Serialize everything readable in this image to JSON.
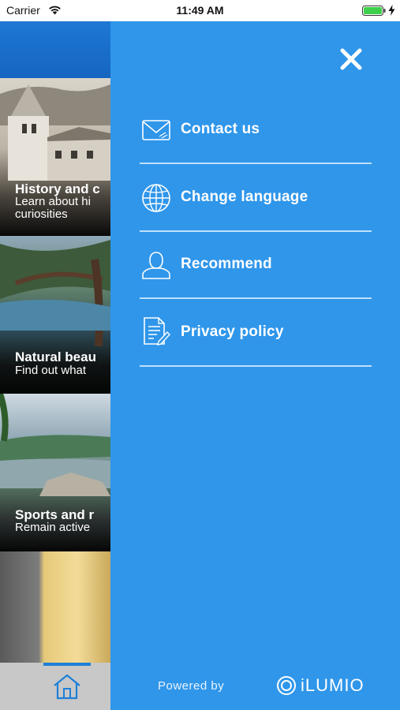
{
  "status_bar": {
    "carrier": "Carrier",
    "time": "11:49 AM"
  },
  "main": {
    "cards": [
      {
        "title": "History and c",
        "subtitle_line1": "Learn about hi",
        "subtitle_line2": "curiosities"
      },
      {
        "title": "Natural beau",
        "subtitle_line1": "Find out what"
      },
      {
        "title": "Sports and r",
        "subtitle_line1": "Remain active"
      },
      {
        "title": ""
      }
    ],
    "tab_bar": {
      "active_tab": "home-icon"
    }
  },
  "drawer": {
    "close_icon": "close-icon",
    "menu": [
      {
        "label": "Contact us",
        "icon": "envelope-icon"
      },
      {
        "label": "Change language",
        "icon": "globe-icon"
      },
      {
        "label": "Recommend",
        "icon": "user-icon"
      },
      {
        "label": "Privacy policy",
        "icon": "document-icon"
      }
    ],
    "footer": {
      "powered_by": "Powered by",
      "brand": "iLUMIO"
    }
  },
  "colors": {
    "drawer_background": "#2f96ea",
    "header_blue": "#1e78d4",
    "divider": "#bfe0fb",
    "tab_bar": "#c8c8c8"
  }
}
